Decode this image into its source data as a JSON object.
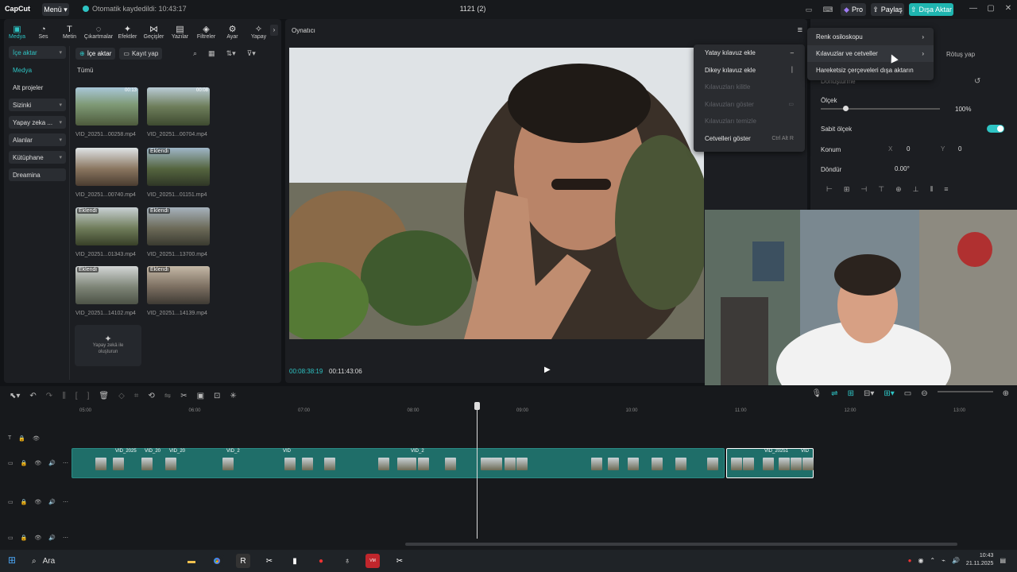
{
  "titlebar": {
    "app_logo": "CapCut",
    "menu_label": "Menü",
    "autosave_status": "Otomatik kaydedildi: 10:43:17",
    "project_title": "1121 (2)",
    "pro_label": "Pro",
    "share_label": "Paylaş",
    "export_label": "Dışa Aktar"
  },
  "left_tabs": [
    {
      "label": "Medya",
      "icon": "media-icon"
    },
    {
      "label": "Ses",
      "icon": "audio-icon"
    },
    {
      "label": "Metin",
      "icon": "text-icon"
    },
    {
      "label": "Çıkartmalar",
      "icon": "sticker-icon"
    },
    {
      "label": "Efektler",
      "icon": "effects-icon"
    },
    {
      "label": "Geçişler",
      "icon": "transitions-icon"
    },
    {
      "label": "Yazılar",
      "icon": "captions-icon"
    },
    {
      "label": "Filtreler",
      "icon": "filters-icon"
    },
    {
      "label": "Ayar",
      "icon": "adjust-icon"
    },
    {
      "label": "Yapay",
      "icon": "ai-icon"
    }
  ],
  "side_nav": [
    {
      "label": "İçe aktar",
      "has_caret": true
    },
    {
      "label": "Medya",
      "has_caret": false
    },
    {
      "label": "Alt projeler",
      "has_caret": false
    },
    {
      "label": "Sizinki",
      "has_caret": true
    },
    {
      "label": "Yapay zeka ...",
      "has_caret": true
    },
    {
      "label": "Alanlar",
      "has_caret": true
    },
    {
      "label": "Kütüphane",
      "has_caret": true
    },
    {
      "label": "Dreamina",
      "has_caret": false
    }
  ],
  "media": {
    "import_label": "İçe aktar",
    "record_label": "Kayıt yap",
    "filter_all": "Tümü",
    "clips": [
      {
        "name": "VID_20251...00258.mp4",
        "badge": "",
        "duration": "00:13"
      },
      {
        "name": "VID_20251...00704.mp4",
        "badge": "",
        "duration": "00:08"
      },
      {
        "name": "VID_20251...00740.mp4",
        "badge": "",
        "duration": ""
      },
      {
        "name": "VID_20251...01151.mp4",
        "badge": "Eklendi",
        "duration": ""
      },
      {
        "name": "VID_20251...01343.mp4",
        "badge": "Eklendi",
        "duration": ""
      },
      {
        "name": "VID_20251...13700.mp4",
        "badge": "Eklendi",
        "duration": ""
      },
      {
        "name": "VID_20251...14102.mp4",
        "badge": "Eklendi",
        "duration": ""
      },
      {
        "name": "VID_20251...14139.mp4",
        "badge": "Eklendi",
        "duration": ""
      }
    ],
    "ai_card": "Yapay zekâ ile oluşturun"
  },
  "player": {
    "title": "Oynatıcı",
    "current_time": "00:08:38:19",
    "total_time": "00:11:43:06"
  },
  "context_menu": {
    "items": [
      {
        "label": "Yatay kılavuz ekle",
        "shortcut": "",
        "disabled": false
      },
      {
        "label": "Dikey kılavuz ekle",
        "shortcut": "",
        "disabled": false
      },
      {
        "label": "Kılavuzları kilitle",
        "shortcut": "",
        "disabled": true
      },
      {
        "label": "Kılavuzları göster",
        "shortcut": "",
        "disabled": true
      },
      {
        "label": "Kılavuzları temizle",
        "shortcut": "",
        "disabled": true
      },
      {
        "label": "Cetvelleri göster",
        "shortcut": "Ctrl Alt R",
        "disabled": false
      }
    ]
  },
  "submenu": {
    "items": [
      {
        "label": "Renk osiloskopu",
        "arrow": true
      },
      {
        "label": "Kılavuzlar ve cetveller",
        "arrow": true
      },
      {
        "label": "Hareketsiz çerçeveleri dışa aktarın",
        "arrow": false
      }
    ]
  },
  "right_panel": {
    "retouch_tab": "Rötuş yap",
    "section": "Dönüştürme",
    "scale_label": "Ölçek",
    "scale_value": "100%",
    "scale_level": 1.0,
    "uniform_scale_label": "Sabit ölçek",
    "position_label": "Konum",
    "pos_x_label": "X",
    "pos_x": "0",
    "pos_y_label": "Y",
    "pos_y": "0",
    "rotate_label": "Döndür",
    "rotate_value": "0.00°"
  },
  "timeline": {
    "ruler": [
      "05:00",
      "06:00",
      "07:00",
      "08:00",
      "09:00",
      "10:00",
      "11:00",
      "12:00",
      "13:00"
    ],
    "clip_labels": [
      "VID_2025",
      "VID_20",
      "VID_20",
      "VID_2",
      "VID",
      "VID_2",
      "VID_20251",
      "VID"
    ]
  },
  "taskbar": {
    "search_label": "Ara",
    "time": "10:43",
    "date": "21.11.2025"
  },
  "colors": {
    "accent": "#2ec4c4",
    "clip": "#1f6e69",
    "export": "#1fb5b0"
  }
}
